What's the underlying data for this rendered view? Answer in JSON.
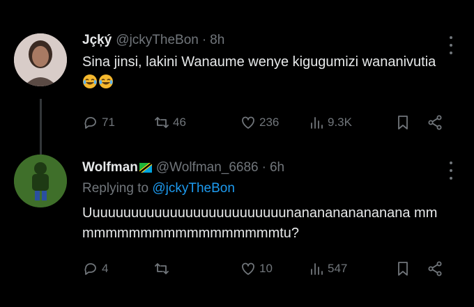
{
  "tweets": [
    {
      "display_name": "Jçķý",
      "handle": "@jckyTheBon",
      "time": "8h",
      "text": "Sina jinsi, lakini Wanaume wenye kigugumizi wananivutia",
      "emoji": "😂😂",
      "replies": "71",
      "retweets": "46",
      "likes": "236",
      "views": "9.3K"
    },
    {
      "display_name": "Wolfman",
      "handle": "@Wolfman_6686",
      "time": "6h",
      "replying_label": "Replying to",
      "replying_to": "@jckyTheBon",
      "text": "Uuuuuuuuuuuuuuuuuuuuuuuuuunananananananana mmmmmmmmmmmmmmmmmmmtu?",
      "replies": "4",
      "retweets": "",
      "likes": "10",
      "views": "547"
    }
  ],
  "separator": "·",
  "icons": [
    "reply-icon",
    "retweet-icon",
    "like-icon",
    "views-icon",
    "bookmark-icon",
    "share-icon",
    "more-options-icon"
  ],
  "colors": {
    "background": "#000000",
    "text": "#e7e9ea",
    "muted": "#71767b",
    "link": "#1d9bf0"
  }
}
